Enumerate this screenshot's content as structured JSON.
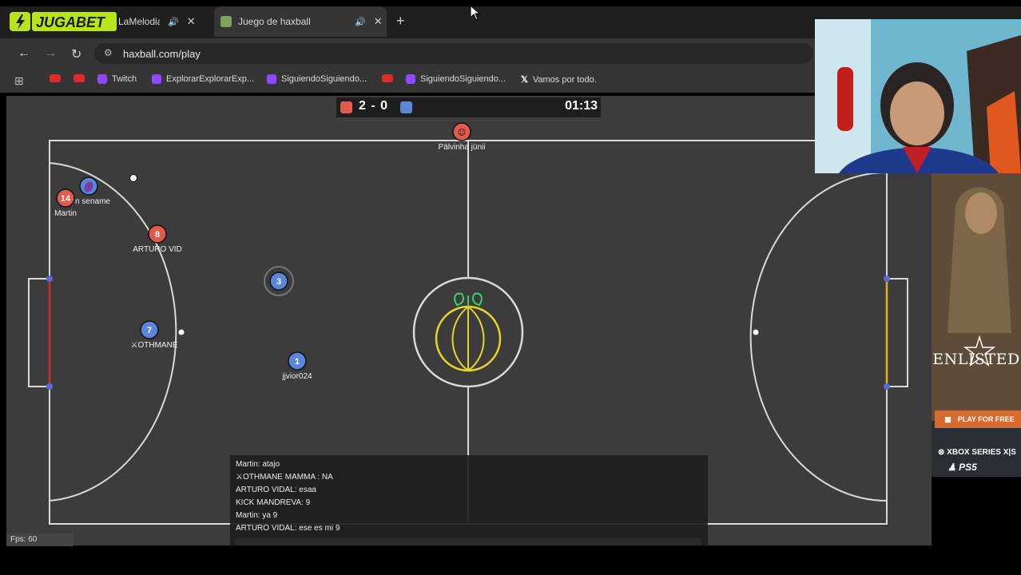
{
  "browser": {
    "tabs": [
      {
        "title": "LaMelodia",
        "active": false
      },
      {
        "title": "Juego de haxball",
        "active": true
      }
    ],
    "address": "haxball.com/play",
    "bookmarks": [
      "Twitch",
      "ExplorarExplorarExp...",
      "SiguiendoSiguiendo...",
      "SiguiendoSiguiendo...",
      "Vamos por todo."
    ]
  },
  "overlay": {
    "brand": "JUGABET"
  },
  "game": {
    "score_text": "2 - 0",
    "clock": "01:13",
    "colors": {
      "red_team": "#e05b4c",
      "blue_team": "#5a86d8",
      "field_line": "#d9d9d9",
      "red_goal": "#d82a2a",
      "yellow_goal": "#e0b21a"
    },
    "players": [
      {
        "team": "red",
        "number": "",
        "label": "Pälvinha jünii",
        "icon": "smile-icon"
      },
      {
        "team": "blue",
        "number": "",
        "label": "n sename",
        "icon": "eggplant-icon"
      },
      {
        "team": "red",
        "number": "14",
        "label": "Martin"
      },
      {
        "team": "red",
        "number": "8",
        "label": "ARTURO VID"
      },
      {
        "team": "blue",
        "number": "3",
        "label": ""
      },
      {
        "team": "blue",
        "number": "7",
        "label": "OTHMANE"
      },
      {
        "team": "blue",
        "number": "1",
        "label": "jjvior024"
      }
    ],
    "fps": "Fps: 60"
  },
  "chat": {
    "messages": [
      "Martin: atajo",
      "OTHMANE MAMMA : NA",
      "ARTURO VIDAL: esaa",
      "KICK MANDREVA: 9",
      "Martin: ya 9",
      "ARTURO VIDAL: ese es mi 9"
    ]
  },
  "ad": {
    "title": "ENLISTED",
    "cta": "PLAY FOR FREE",
    "platform1": "XBOX SERIES X|S",
    "platform2": "PS5"
  }
}
